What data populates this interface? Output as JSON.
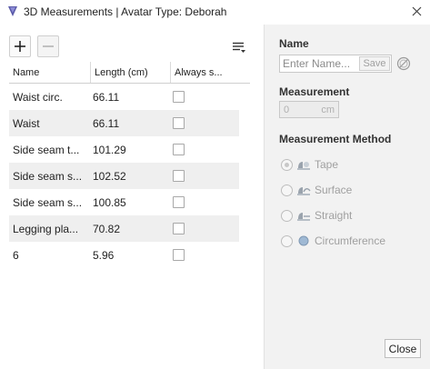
{
  "window": {
    "title": "3D Measurements | Avatar Type: Deborah",
    "app_icon": "app-logo-icon",
    "close_icon": "close-icon"
  },
  "toolbar": {
    "add_icon": "plus-icon",
    "remove_icon": "minus-icon",
    "menu_icon": "menu-icon"
  },
  "table": {
    "headers": [
      "Name",
      "Length (cm)",
      "Always s..."
    ],
    "rows": [
      {
        "name": "Waist circ.",
        "length": "66.11",
        "always": false
      },
      {
        "name": "Waist",
        "length": "66.11",
        "always": false
      },
      {
        "name": "Side seam t...",
        "length": "101.29",
        "always": false
      },
      {
        "name": "Side seam s...",
        "length": "102.52",
        "always": false
      },
      {
        "name": "Side seam s...",
        "length": "100.85",
        "always": false
      },
      {
        "name": "Legging pla...",
        "length": "70.82",
        "always": false
      },
      {
        "name": "6",
        "length": "5.96",
        "always": false
      }
    ]
  },
  "panel": {
    "name_label": "Name",
    "name_placeholder": "Enter Name...",
    "name_value": "",
    "save_label": "Save",
    "measurement_label": "Measurement",
    "measurement_value": "0",
    "measurement_unit": "cm",
    "method_label": "Measurement Method",
    "methods": [
      {
        "label": "Tape",
        "icon": "tape-measure-icon",
        "selected": true
      },
      {
        "label": "Surface",
        "icon": "surface-measure-icon",
        "selected": false
      },
      {
        "label": "Straight",
        "icon": "straight-measure-icon",
        "selected": false
      },
      {
        "label": "Circumference",
        "icon": "circumference-measure-icon",
        "selected": false
      }
    ],
    "close_label": "Close"
  }
}
